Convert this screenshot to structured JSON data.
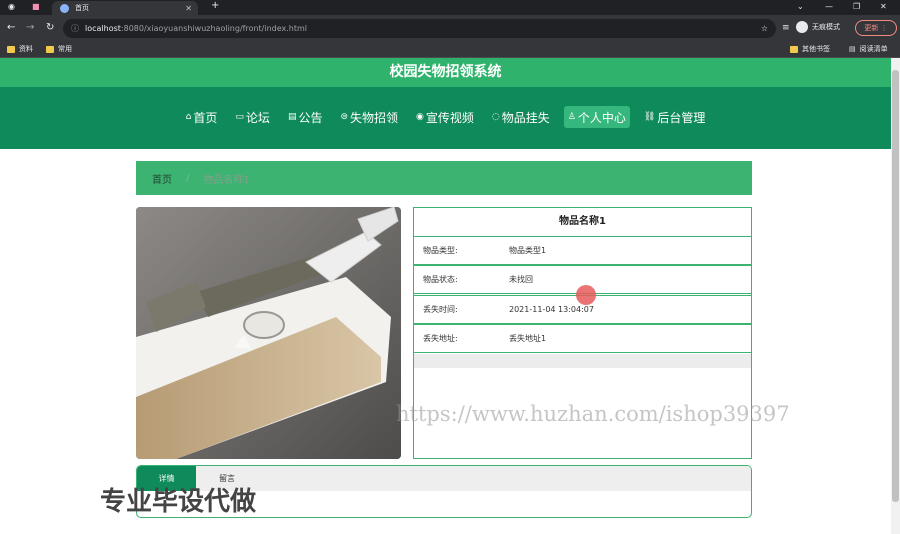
{
  "browser": {
    "tab_title": "首页",
    "url_host": "localhost",
    "url_path": ":8080/xiaoyuanshiwuzhaoling/front/index.html",
    "profile_label": "无痕模式",
    "update_label": "更新",
    "bookmarks": [
      "资料",
      "常用"
    ],
    "bookmarks_right": [
      "其他书签",
      "阅读清单"
    ]
  },
  "site": {
    "title": "校园失物招领系统",
    "nav": [
      {
        "label": "首页",
        "icon": "home-icon"
      },
      {
        "label": "论坛",
        "icon": "forum-icon"
      },
      {
        "label": "公告",
        "icon": "notice-icon"
      },
      {
        "label": "失物招领",
        "icon": "lost-found-icon"
      },
      {
        "label": "宣传视频",
        "icon": "video-icon"
      },
      {
        "label": "物品挂失",
        "icon": "report-icon"
      },
      {
        "label": "个人中心",
        "icon": "user-icon"
      },
      {
        "label": "后台管理",
        "icon": "link-icon"
      }
    ],
    "active_nav": "个人中心"
  },
  "breadcrumb": {
    "home": "首页",
    "current": "物品名称1"
  },
  "item": {
    "name": "物品名称1",
    "rows": [
      {
        "key": "物品类型:",
        "value": "物品类型1"
      },
      {
        "key": "物品状态:",
        "value": "未找回"
      },
      {
        "key": "丢失时间:",
        "value": "2021-11-04 13:04:07"
      },
      {
        "key": "丢失地址:",
        "value": "丢失地址1"
      }
    ]
  },
  "tabs": {
    "detail": "详情",
    "message": "留言"
  },
  "watermarks": {
    "url": "https://www.huzhan.com/ishop39397",
    "text": "专业毕设代做"
  },
  "colors": {
    "primary": "#0f8a5a",
    "accent": "#3cb371",
    "title_bar": "#2fb36c"
  }
}
